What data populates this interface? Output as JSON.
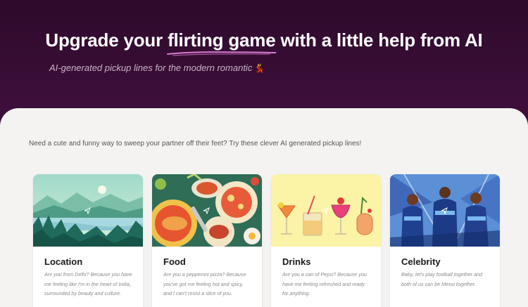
{
  "hero": {
    "title_before": "Upgrade your ",
    "title_highlight": "flirting game",
    "title_after": " with a little help from AI",
    "subtitle": "AI-generated pickup lines for the modern romantic",
    "subtitle_emoji": "💃",
    "accent_color": "#d97ad1"
  },
  "intro": "Need a cute and funny way to sweep your partner off their feet? Try these clever AI generated pickup lines!",
  "cards": [
    {
      "title": "Location",
      "image_icon": "lake-landscape-icon",
      "text": "Are you from Delhi? Because you have me feeling like I'm in the heart of India, surrounded by beauty and culture."
    },
    {
      "title": "Food",
      "image_icon": "food-plates-icon",
      "text": "Are you a pepperoni pizza? Because you've got me feeling hot and spicy, and I can't resist a slice of you."
    },
    {
      "title": "Drinks",
      "image_icon": "cocktails-icon",
      "text": "Are you a can of Pepsi? Because you have me feeling refreshed and ready for anything."
    },
    {
      "title": "Celebrity",
      "image_icon": "football-players-icon",
      "text": "Baby, let's play football together and both of us can be Messi together."
    }
  ]
}
